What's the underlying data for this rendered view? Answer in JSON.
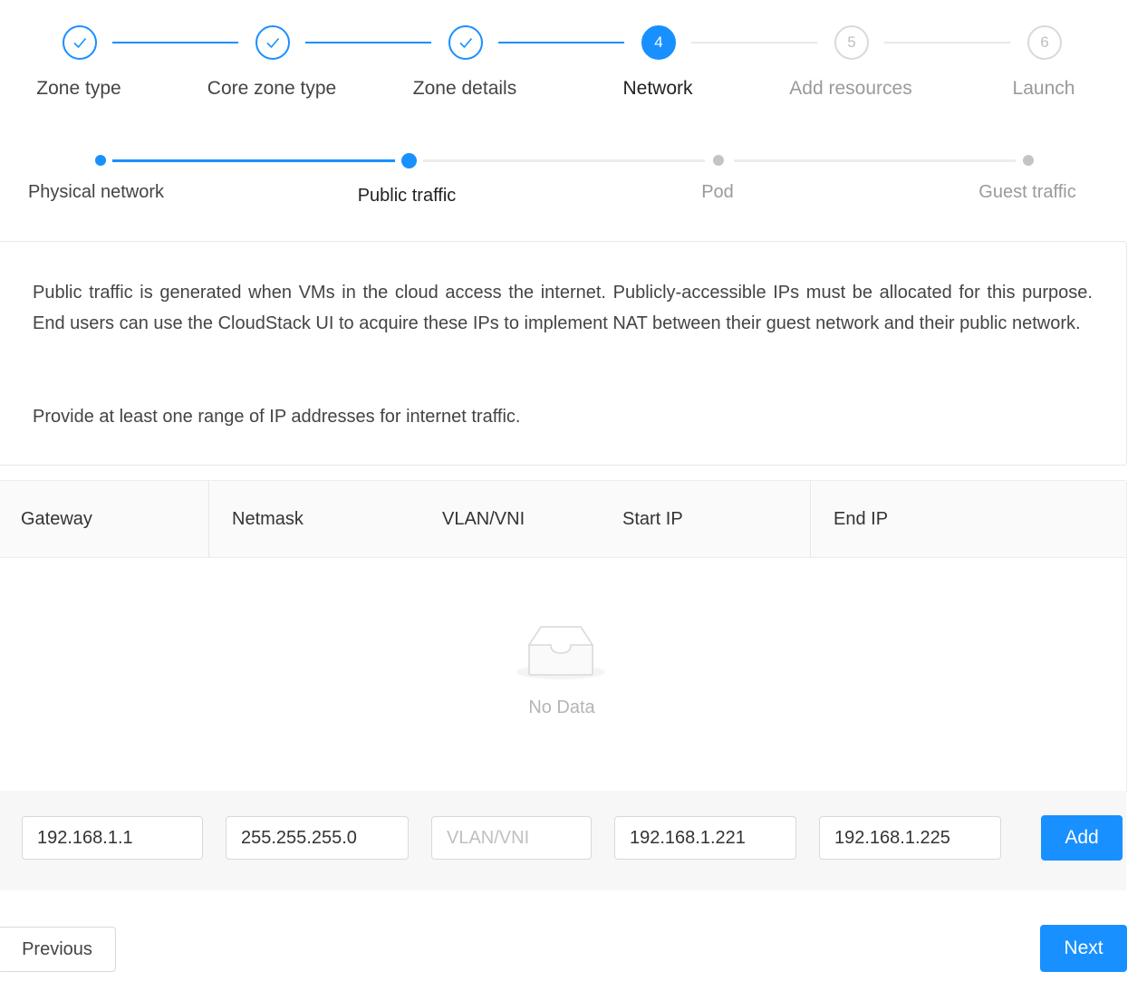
{
  "steps": [
    {
      "label": "Zone type",
      "status": "done"
    },
    {
      "label": "Core zone type",
      "status": "done"
    },
    {
      "label": "Zone details",
      "status": "done"
    },
    {
      "label": "Network",
      "status": "active",
      "number": "4"
    },
    {
      "label": "Add resources",
      "status": "wait",
      "number": "5"
    },
    {
      "label": "Launch",
      "status": "wait",
      "number": "6"
    }
  ],
  "sub_steps": [
    {
      "label": "Physical network",
      "status": "done"
    },
    {
      "label": "Public traffic",
      "status": "active"
    },
    {
      "label": "Pod",
      "status": "wait"
    },
    {
      "label": "Guest traffic",
      "status": "wait"
    }
  ],
  "description": {
    "paragraph1": "Public traffic is generated when VMs in the cloud access the internet. Publicly-accessible IPs must be allocated for this purpose. End users can use the CloudStack UI to acquire these IPs to implement NAT between their guest network and their public network.",
    "paragraph2": "Provide at least one range of IP addresses for internet traffic."
  },
  "table": {
    "columns": [
      "Gateway",
      "Netmask",
      "VLAN/VNI",
      "Start IP",
      "End IP"
    ],
    "empty_text": "No Data"
  },
  "form": {
    "gateway": {
      "value": "192.168.1.1"
    },
    "netmask": {
      "value": "255.255.255.0"
    },
    "vlan": {
      "value": "",
      "placeholder": "VLAN/VNI"
    },
    "start_ip": {
      "value": "192.168.1.221"
    },
    "end_ip": {
      "value": "192.168.1.225"
    },
    "add_label": "Add"
  },
  "footer": {
    "previous_label": "Previous",
    "next_label": "Next"
  },
  "colors": {
    "primary": "#1890ff",
    "wait": "#d9d9d9"
  },
  "icons": {
    "done_step": "check-icon",
    "empty": "inbox-icon"
  }
}
